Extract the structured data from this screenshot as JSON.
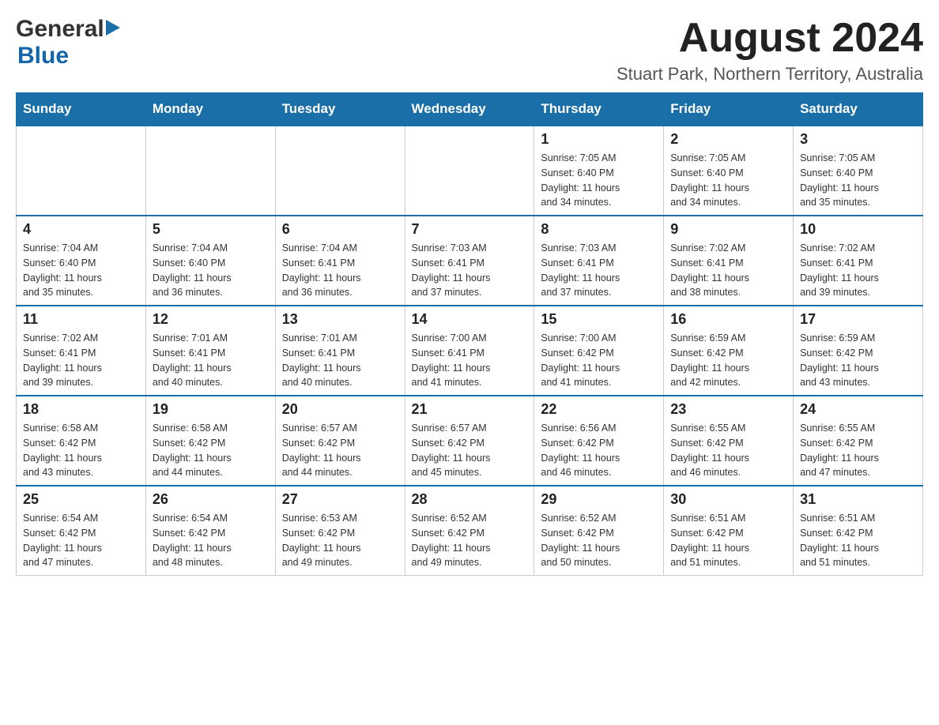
{
  "header": {
    "logo_general": "General",
    "logo_blue": "Blue",
    "month_title": "August 2024",
    "location": "Stuart Park, Northern Territory, Australia"
  },
  "days_of_week": [
    "Sunday",
    "Monday",
    "Tuesday",
    "Wednesday",
    "Thursday",
    "Friday",
    "Saturday"
  ],
  "weeks": [
    {
      "days": [
        {
          "number": "",
          "info": ""
        },
        {
          "number": "",
          "info": ""
        },
        {
          "number": "",
          "info": ""
        },
        {
          "number": "",
          "info": ""
        },
        {
          "number": "1",
          "info": "Sunrise: 7:05 AM\nSunset: 6:40 PM\nDaylight: 11 hours\nand 34 minutes."
        },
        {
          "number": "2",
          "info": "Sunrise: 7:05 AM\nSunset: 6:40 PM\nDaylight: 11 hours\nand 34 minutes."
        },
        {
          "number": "3",
          "info": "Sunrise: 7:05 AM\nSunset: 6:40 PM\nDaylight: 11 hours\nand 35 minutes."
        }
      ]
    },
    {
      "days": [
        {
          "number": "4",
          "info": "Sunrise: 7:04 AM\nSunset: 6:40 PM\nDaylight: 11 hours\nand 35 minutes."
        },
        {
          "number": "5",
          "info": "Sunrise: 7:04 AM\nSunset: 6:40 PM\nDaylight: 11 hours\nand 36 minutes."
        },
        {
          "number": "6",
          "info": "Sunrise: 7:04 AM\nSunset: 6:41 PM\nDaylight: 11 hours\nand 36 minutes."
        },
        {
          "number": "7",
          "info": "Sunrise: 7:03 AM\nSunset: 6:41 PM\nDaylight: 11 hours\nand 37 minutes."
        },
        {
          "number": "8",
          "info": "Sunrise: 7:03 AM\nSunset: 6:41 PM\nDaylight: 11 hours\nand 37 minutes."
        },
        {
          "number": "9",
          "info": "Sunrise: 7:02 AM\nSunset: 6:41 PM\nDaylight: 11 hours\nand 38 minutes."
        },
        {
          "number": "10",
          "info": "Sunrise: 7:02 AM\nSunset: 6:41 PM\nDaylight: 11 hours\nand 39 minutes."
        }
      ]
    },
    {
      "days": [
        {
          "number": "11",
          "info": "Sunrise: 7:02 AM\nSunset: 6:41 PM\nDaylight: 11 hours\nand 39 minutes."
        },
        {
          "number": "12",
          "info": "Sunrise: 7:01 AM\nSunset: 6:41 PM\nDaylight: 11 hours\nand 40 minutes."
        },
        {
          "number": "13",
          "info": "Sunrise: 7:01 AM\nSunset: 6:41 PM\nDaylight: 11 hours\nand 40 minutes."
        },
        {
          "number": "14",
          "info": "Sunrise: 7:00 AM\nSunset: 6:41 PM\nDaylight: 11 hours\nand 41 minutes."
        },
        {
          "number": "15",
          "info": "Sunrise: 7:00 AM\nSunset: 6:42 PM\nDaylight: 11 hours\nand 41 minutes."
        },
        {
          "number": "16",
          "info": "Sunrise: 6:59 AM\nSunset: 6:42 PM\nDaylight: 11 hours\nand 42 minutes."
        },
        {
          "number": "17",
          "info": "Sunrise: 6:59 AM\nSunset: 6:42 PM\nDaylight: 11 hours\nand 43 minutes."
        }
      ]
    },
    {
      "days": [
        {
          "number": "18",
          "info": "Sunrise: 6:58 AM\nSunset: 6:42 PM\nDaylight: 11 hours\nand 43 minutes."
        },
        {
          "number": "19",
          "info": "Sunrise: 6:58 AM\nSunset: 6:42 PM\nDaylight: 11 hours\nand 44 minutes."
        },
        {
          "number": "20",
          "info": "Sunrise: 6:57 AM\nSunset: 6:42 PM\nDaylight: 11 hours\nand 44 minutes."
        },
        {
          "number": "21",
          "info": "Sunrise: 6:57 AM\nSunset: 6:42 PM\nDaylight: 11 hours\nand 45 minutes."
        },
        {
          "number": "22",
          "info": "Sunrise: 6:56 AM\nSunset: 6:42 PM\nDaylight: 11 hours\nand 46 minutes."
        },
        {
          "number": "23",
          "info": "Sunrise: 6:55 AM\nSunset: 6:42 PM\nDaylight: 11 hours\nand 46 minutes."
        },
        {
          "number": "24",
          "info": "Sunrise: 6:55 AM\nSunset: 6:42 PM\nDaylight: 11 hours\nand 47 minutes."
        }
      ]
    },
    {
      "days": [
        {
          "number": "25",
          "info": "Sunrise: 6:54 AM\nSunset: 6:42 PM\nDaylight: 11 hours\nand 47 minutes."
        },
        {
          "number": "26",
          "info": "Sunrise: 6:54 AM\nSunset: 6:42 PM\nDaylight: 11 hours\nand 48 minutes."
        },
        {
          "number": "27",
          "info": "Sunrise: 6:53 AM\nSunset: 6:42 PM\nDaylight: 11 hours\nand 49 minutes."
        },
        {
          "number": "28",
          "info": "Sunrise: 6:52 AM\nSunset: 6:42 PM\nDaylight: 11 hours\nand 49 minutes."
        },
        {
          "number": "29",
          "info": "Sunrise: 6:52 AM\nSunset: 6:42 PM\nDaylight: 11 hours\nand 50 minutes."
        },
        {
          "number": "30",
          "info": "Sunrise: 6:51 AM\nSunset: 6:42 PM\nDaylight: 11 hours\nand 51 minutes."
        },
        {
          "number": "31",
          "info": "Sunrise: 6:51 AM\nSunset: 6:42 PM\nDaylight: 11 hours\nand 51 minutes."
        }
      ]
    }
  ]
}
